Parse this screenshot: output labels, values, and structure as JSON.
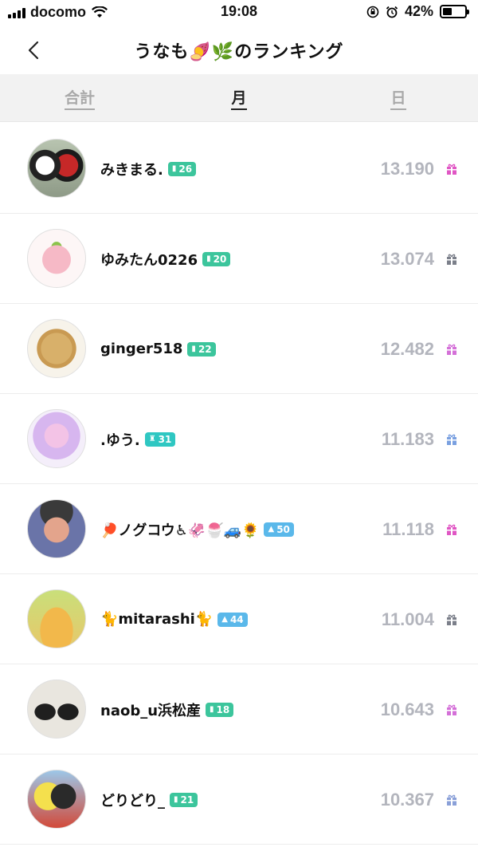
{
  "status_bar": {
    "carrier": "docomo",
    "time": "19:08",
    "battery_percent": "42%",
    "battery_level": 0.42,
    "icons": [
      "signal-icon",
      "wifi-icon",
      "orientation-lock-icon",
      "alarm-icon",
      "battery-icon"
    ]
  },
  "header": {
    "title": "うなも🍠🌿のランキング",
    "back_icon": "chevron-left-icon"
  },
  "tabs": [
    {
      "label": "合計",
      "active": false
    },
    {
      "label": "月",
      "active": true
    },
    {
      "label": "日",
      "active": false
    }
  ],
  "ranking": [
    {
      "name": "みきまる.",
      "badge": "26",
      "badge_color": "#3cc59c",
      "score": "13.190",
      "gift_color": "#e056c4"
    },
    {
      "name": "ゆみたん0226",
      "badge": "20",
      "badge_color": "#3cc59c",
      "score": "13.074",
      "gift_color": "#7b7f8a"
    },
    {
      "name": "ginger518",
      "badge": "22",
      "badge_color": "#3cc59c",
      "score": "12.482",
      "gift_color": "#d470d8"
    },
    {
      "name": ".ゆう.",
      "badge": "31",
      "badge_color": "#2fc7c2",
      "score": "11.183",
      "gift_color": "#7aa0e0"
    },
    {
      "name": "🏓ノグコウ♿🦑🍧🚙🌻",
      "badge": "50",
      "badge_color": "#5ab8ea",
      "score": "11.118",
      "gift_color": "#e056c4"
    },
    {
      "name": "🐈mitarashi🐈",
      "badge": "44",
      "badge_color": "#5ab8ea",
      "score": "11.004",
      "gift_color": "#7b7f8a"
    },
    {
      "name": "naob_u浜松産",
      "badge": "18",
      "badge_color": "#3cc59c",
      "score": "10.643",
      "gift_color": "#d470d8"
    },
    {
      "name": "どりどり_",
      "badge": "21",
      "badge_color": "#3cc59c",
      "score": "10.367",
      "gift_color": "#8aa0d8"
    }
  ]
}
